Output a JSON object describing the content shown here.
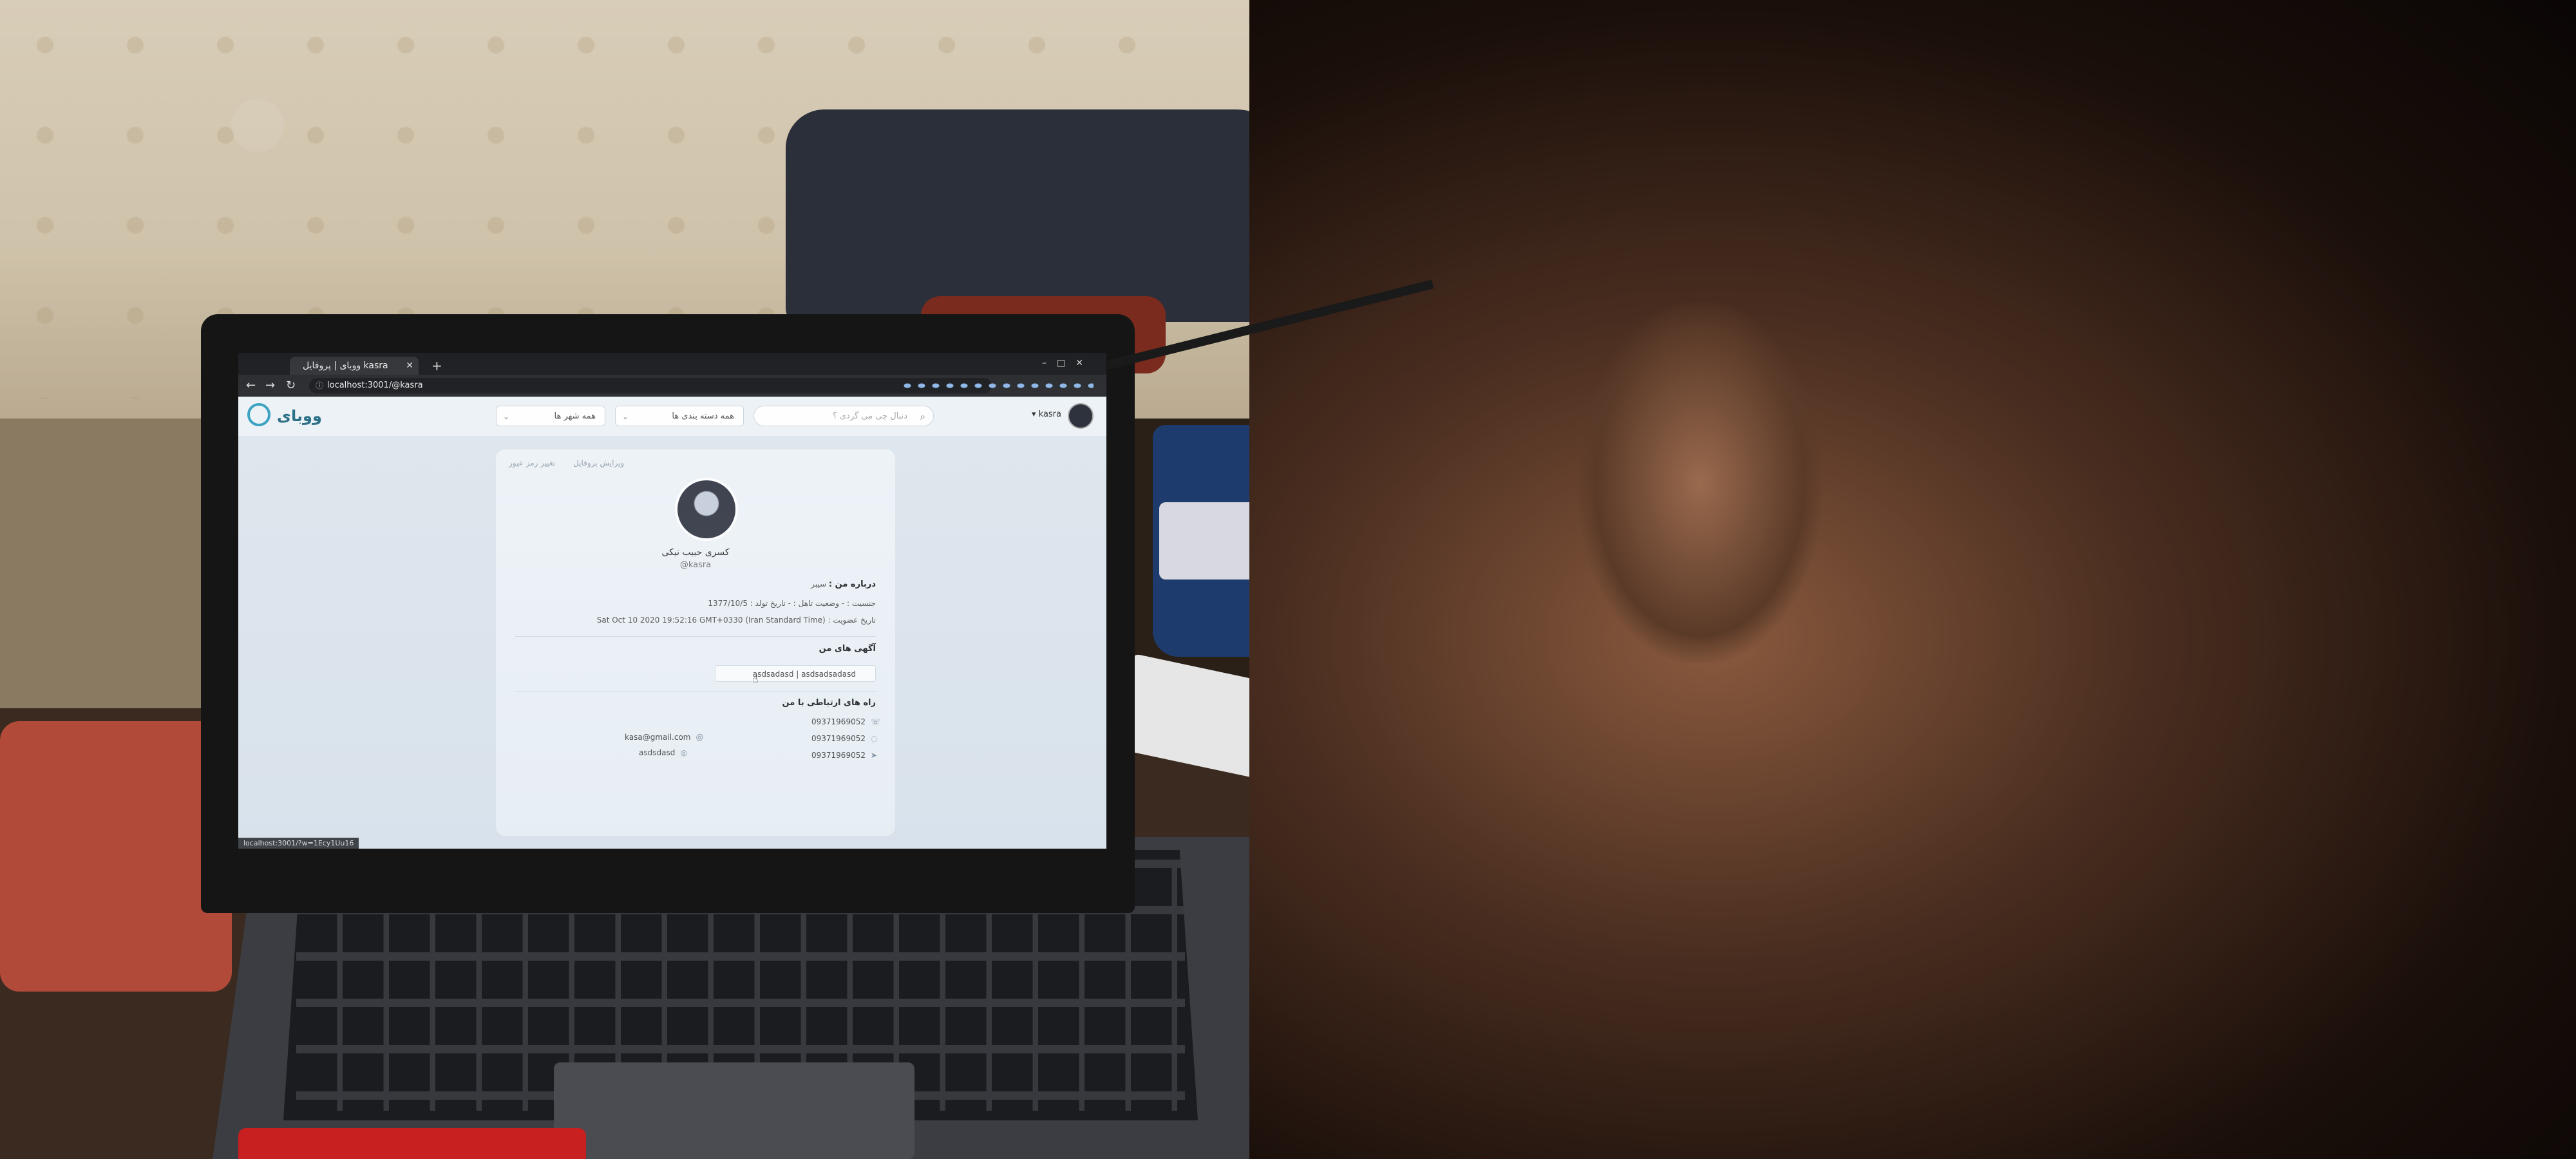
{
  "browser": {
    "tab_title": "ووبای | پروفایل kasra",
    "new_tab": "+",
    "url": "localhost:3001/@kasra",
    "status_url": "localhost:3001/?w=1Ecy1Uu16"
  },
  "app": {
    "logo": "ووبای",
    "city_select": "همه شهر ها",
    "category_select": "همه دسته بندی ها",
    "search_placeholder": "دنبال چی می گردی ؟",
    "username": "kasra"
  },
  "profile": {
    "tabs": [
      "ویرایش پروفایل",
      "تغییر رمز عبور"
    ],
    "name": "کسری حبیب نیکی",
    "handle": "@kasra",
    "about_label": "درباره من :",
    "about_value": "سیبر",
    "details_line": "جنسیت : - وضعیت تاهل : - تاریخ تولد : 1377/10/5",
    "join_label": "تاریخ عضویت :",
    "join_value": "Sat Oct 10 2020 19:52:16 GMT+0330 (Iran Standard Time)",
    "ads_title": "آگهی های من",
    "ad_item": "asdsadasd | asdsadsadasd",
    "contact_title": "راه های ارتباطی با من",
    "phones": [
      "09371969052",
      "09371969052",
      "09371969052"
    ],
    "email": "kasa@gmail.com",
    "instagram": "asdsdasd"
  }
}
